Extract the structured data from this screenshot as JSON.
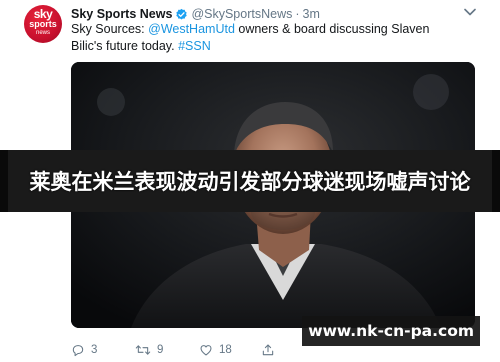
{
  "account": {
    "logo_sky": "sky",
    "logo_sports": "sports",
    "logo_news": "news",
    "display_name": "Sky Sports News",
    "handle": "@SkySportsNews",
    "separator": "·",
    "timestamp": "3m",
    "verified_icon": "verified-badge-icon"
  },
  "tweet": {
    "text_prefix": "Sky Sources: ",
    "mention": "@WestHamUtd",
    "text_middle": " owners & board discussing Slaven Bilic's future today. ",
    "hashtag": "#SSN"
  },
  "overlay": {
    "caption": "莱奥在米兰表现波动引发部分球迷现场嘘声讨论",
    "watermark": "www.nk-cn-pa.com"
  },
  "actions": {
    "reply_count": "3",
    "retweet_count": "9",
    "like_count": "18"
  },
  "colors": {
    "brand_red": "#c8102e",
    "link_blue": "#1b95e0",
    "verified_blue": "#1da1f2",
    "muted_gray": "#657786"
  }
}
